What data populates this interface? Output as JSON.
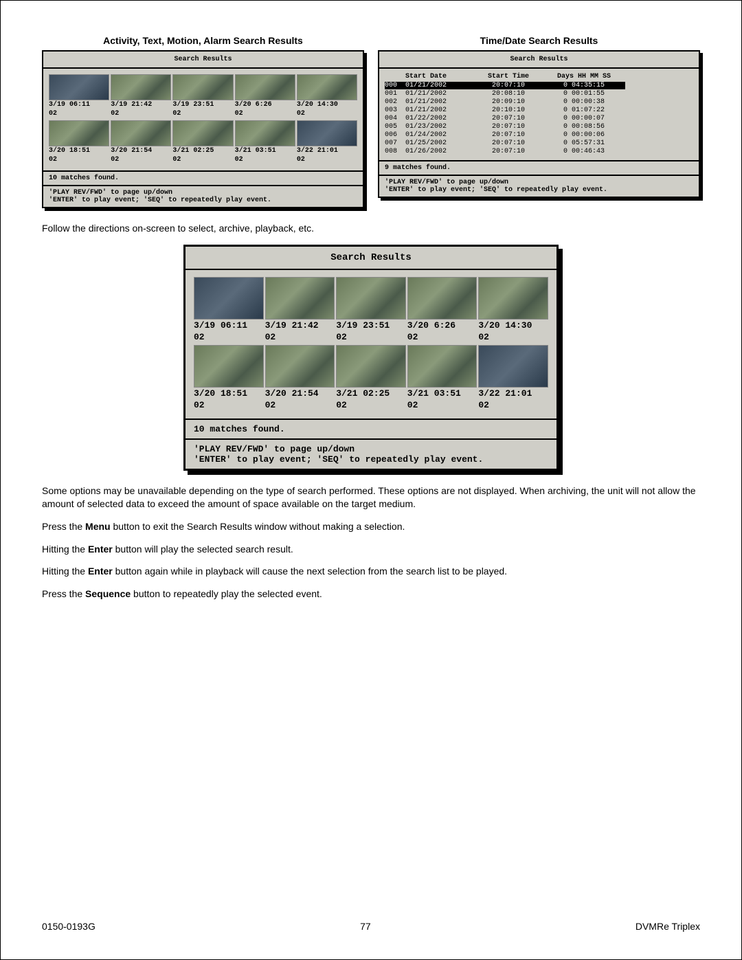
{
  "headings": {
    "left": "Activity, Text, Motion, Alarm Search Results",
    "right": "Time/Date Search Results"
  },
  "panel_common": {
    "title": "Search Results",
    "footer_nav": "'PLAY REV/FWD' to page up/down",
    "footer_play": "'ENTER' to play event; 'SEQ' to repeatedly play event."
  },
  "left_small": {
    "row1_times": [
      "3/19 06:11",
      "3/19 21:42",
      "3/19 23:51",
      "3/20 6:26",
      "3/20 14:30"
    ],
    "row1_cams": [
      "02",
      "02",
      "02",
      "02",
      "02"
    ],
    "row2_times": [
      "3/20 18:51",
      "3/20 21:54",
      "3/21 02:25",
      "3/21 03:51",
      "3/22 21:01"
    ],
    "row2_cams": [
      "02",
      "02",
      "02",
      "02",
      "02"
    ],
    "matches": "10   matches found."
  },
  "right_small": {
    "headers": {
      "date": "Start Date",
      "time": "Start Time",
      "dur": "Days HH MM SS"
    },
    "rows": [
      {
        "idx": "000",
        "date": "01/21/2002",
        "time": "20:07:10",
        "dur": "0 04:35:15",
        "hl": true
      },
      {
        "idx": "001",
        "date": "01/21/2002",
        "time": "20:08:10",
        "dur": "0 00:01:55"
      },
      {
        "idx": "002",
        "date": "01/21/2002",
        "time": "20:09:10",
        "dur": "0 00:00:38"
      },
      {
        "idx": "003",
        "date": "01/21/2002",
        "time": "20:10:10",
        "dur": "0 01:07:22"
      },
      {
        "idx": "004",
        "date": "01/22/2002",
        "time": "20:07:10",
        "dur": "0 00:00:07"
      },
      {
        "idx": "005",
        "date": "01/23/2002",
        "time": "20:07:10",
        "dur": "0 00:08:56"
      },
      {
        "idx": "006",
        "date": "01/24/2002",
        "time": "20:07:10",
        "dur": "0 00:00:06"
      },
      {
        "idx": "007",
        "date": "01/25/2002",
        "time": "20:07:10",
        "dur": "0 05:57:31"
      },
      {
        "idx": "008",
        "date": "01/26/2002",
        "time": "20:07:10",
        "dur": "0 00:46:43"
      }
    ],
    "matches": "9   matches found."
  },
  "big": {
    "row1_times": [
      "3/19 06:11",
      "3/19 21:42",
      "3/19 23:51",
      "3/20 6:26",
      "3/20 14:30"
    ],
    "row1_cams": [
      "02",
      "02",
      "02",
      "02",
      "02"
    ],
    "row2_times": [
      "3/20 18:51",
      "3/20 21:54",
      "3/21 02:25",
      "3/21 03:51",
      "3/22 21:01"
    ],
    "row2_cams": [
      "02",
      "02",
      "02",
      "02",
      "02"
    ],
    "matches": "10   matches found."
  },
  "paragraphs": {
    "p1": "Follow the directions on-screen to select, archive, playback, etc.",
    "p2": "Some options may be unavailable depending on the type of search performed. These options are not displayed. When archiving, the unit will not allow the amount of selected data to exceed the amount of space available on the target medium.",
    "p3a": "Press the ",
    "p3b": "Menu",
    "p3c": " button to exit the Search Results window without making a selection.",
    "p4a": "Hitting the ",
    "p4b": "Enter",
    "p4c": " button will play the selected search result.",
    "p5a": "Hitting the ",
    "p5b": "Enter",
    "p5c": " button again while in playback will cause the next selection from the search list to be played.",
    "p6a": "Press the ",
    "p6b": "Sequence",
    "p6c": " button to repeatedly play the selected event."
  },
  "footer": {
    "left": "0150-0193G",
    "center": "77",
    "right": "DVMRe Triplex"
  }
}
